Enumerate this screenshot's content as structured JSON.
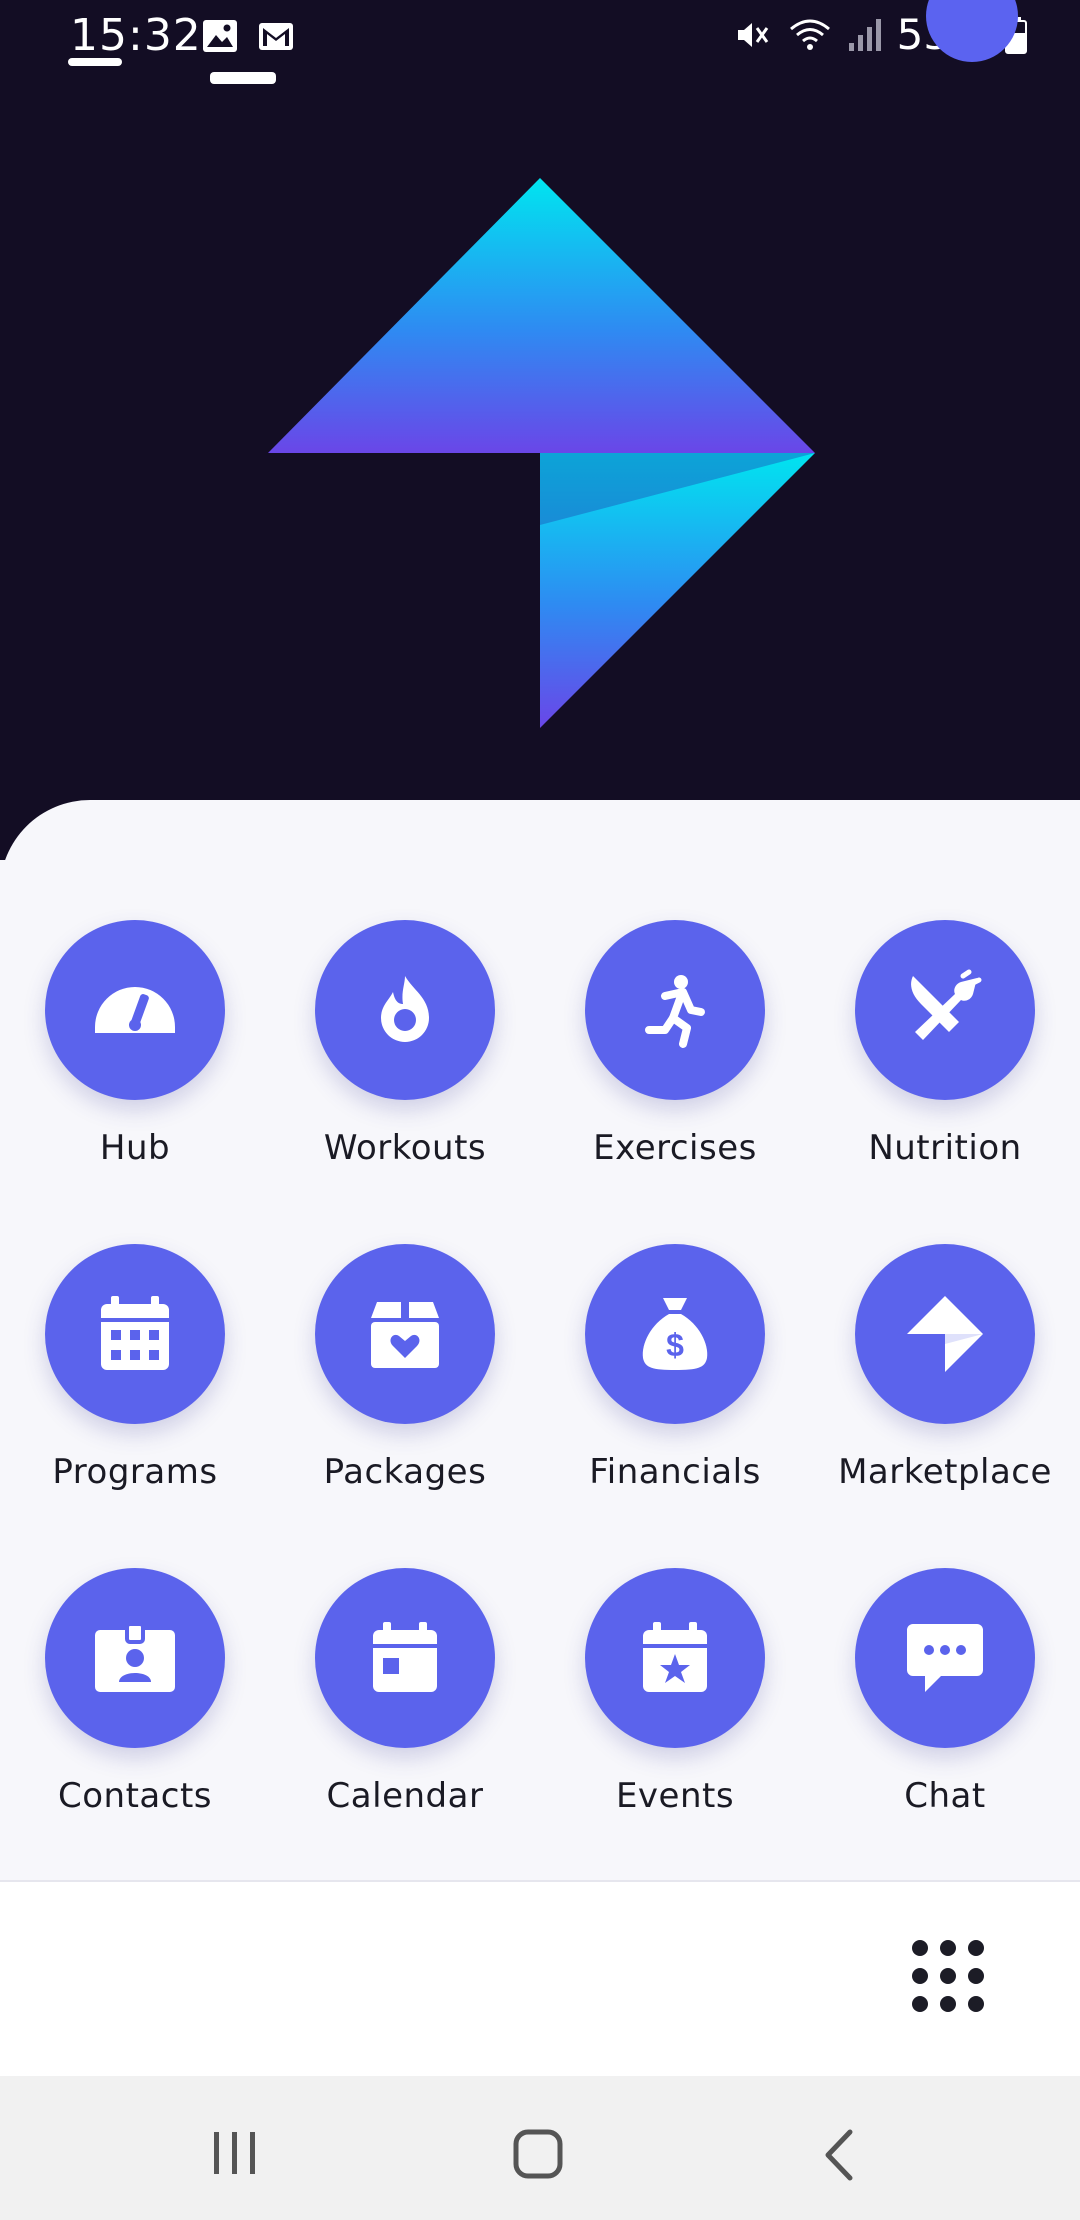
{
  "status_bar": {
    "time": "15:32",
    "battery": "53%",
    "icons": [
      "image-icon",
      "gmail-icon",
      "mute-icon",
      "wifi-icon",
      "signal-icon",
      "battery-icon"
    ]
  },
  "theme": {
    "hero_background": "#130d24",
    "accent": "#5b63ec",
    "panel_background": "#f7f7fb",
    "logo_gradient": [
      "#00e5f0",
      "#2e8bf2",
      "#6a46e8"
    ]
  },
  "menu": {
    "items": [
      {
        "label": "Hub",
        "icon": "speedometer-icon"
      },
      {
        "label": "Workouts",
        "icon": "flame-icon"
      },
      {
        "label": "Exercises",
        "icon": "running-icon"
      },
      {
        "label": "Nutrition",
        "icon": "utensils-icon"
      },
      {
        "label": "Programs",
        "icon": "calendar-grid-icon"
      },
      {
        "label": "Packages",
        "icon": "heart-box-icon"
      },
      {
        "label": "Financials",
        "icon": "money-bag-icon"
      },
      {
        "label": "Marketplace",
        "icon": "brand-arrow-icon"
      },
      {
        "label": "Contacts",
        "icon": "id-card-icon"
      },
      {
        "label": "Calendar",
        "icon": "calendar-icon"
      },
      {
        "label": "Events",
        "icon": "calendar-star-icon"
      },
      {
        "label": "Chat",
        "icon": "chat-bubble-icon"
      }
    ]
  },
  "bottom_bar": {
    "apps_icon": "grid-dots-icon"
  },
  "nav_bar": {
    "buttons": [
      "recents-icon",
      "home-icon",
      "back-icon"
    ]
  }
}
